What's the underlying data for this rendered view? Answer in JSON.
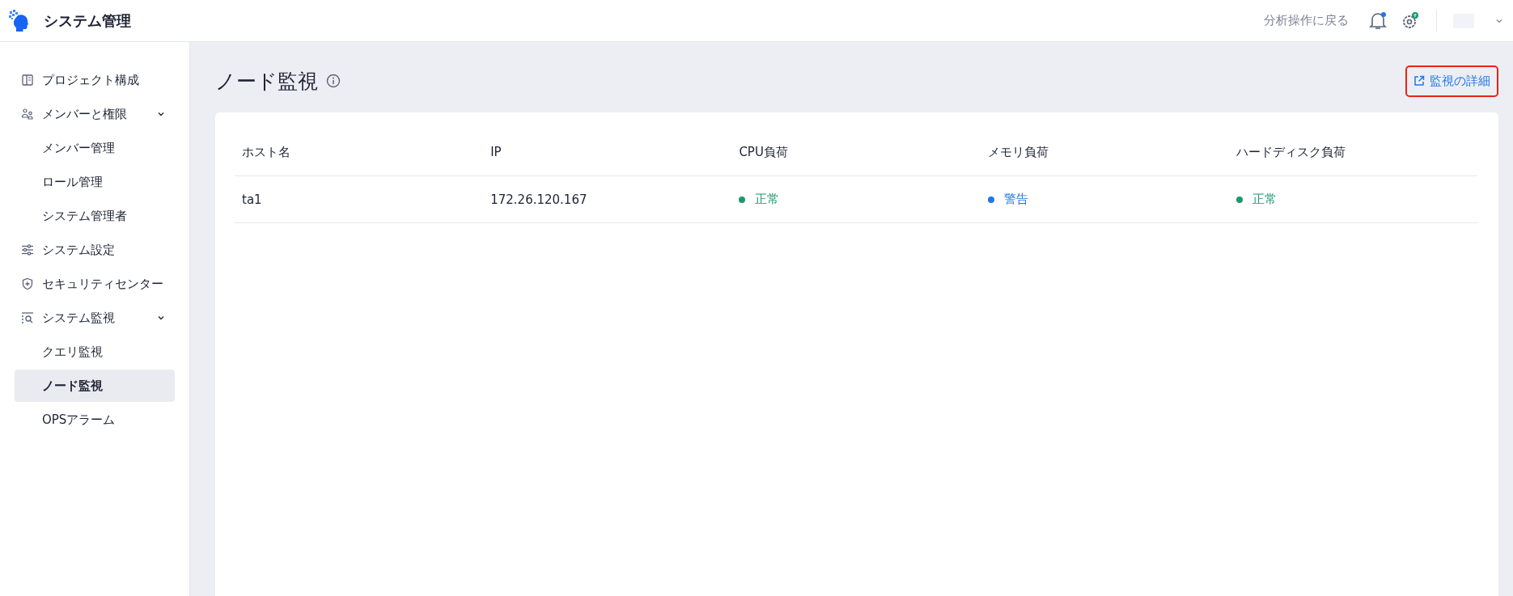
{
  "header": {
    "title": "システム管理",
    "back_link": "分析操作に戻る"
  },
  "sidebar": {
    "items": [
      {
        "label": "プロジェクト構成",
        "selected": false
      },
      {
        "label": "メンバーと権限",
        "expanded": true,
        "children": [
          {
            "label": "メンバー管理",
            "selected": false
          },
          {
            "label": "ロール管理",
            "selected": false
          },
          {
            "label": "システム管理者",
            "selected": false
          }
        ]
      },
      {
        "label": "システム設定",
        "selected": false
      },
      {
        "label": "セキュリティセンター",
        "selected": false
      },
      {
        "label": "システム監視",
        "expanded": true,
        "children": [
          {
            "label": "クエリ監視",
            "selected": false
          },
          {
            "label": "ノード監視",
            "selected": true
          },
          {
            "label": "OPSアラーム",
            "selected": false
          }
        ]
      }
    ]
  },
  "page": {
    "title": "ノード監視",
    "detail_link": "監視の詳細"
  },
  "table": {
    "columns": [
      "ホスト名",
      "IP",
      "CPU負荷",
      "メモリ負荷",
      "ハードディスク負荷"
    ],
    "rows": [
      {
        "host": "ta1",
        "ip": "172.26.120.167",
        "cpu": {
          "label": "正常",
          "color": "#1a9a6c"
        },
        "memory": {
          "label": "警告",
          "color": "#1e78e6"
        },
        "disk": {
          "label": "正常",
          "color": "#1a9a6c"
        }
      }
    ]
  }
}
